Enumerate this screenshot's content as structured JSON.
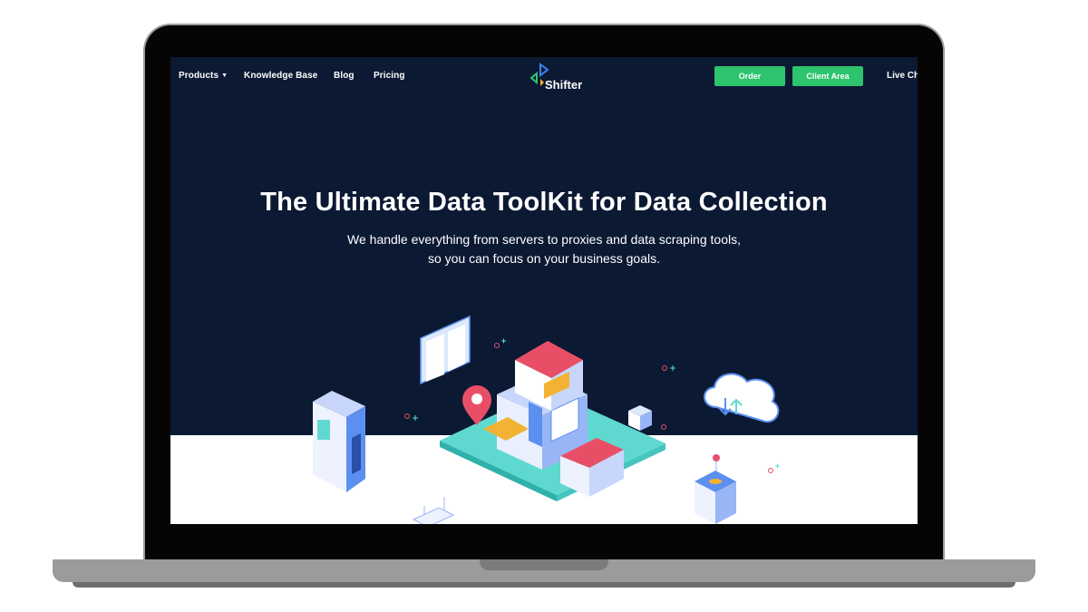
{
  "nav": {
    "products": "Products",
    "knowledge_base": "Knowledge Base",
    "blog": "Blog",
    "pricing": "Pricing",
    "logo_text": "Shifter",
    "order": "Order",
    "client_area": "Client Area",
    "live_chat": "Live Ch"
  },
  "hero": {
    "title": "The Ultimate Data ToolKit for Data Collection",
    "subtitle_line1": "We handle everything from servers to proxies and data scraping tools,",
    "subtitle_line2": "so you can focus on your business goals."
  },
  "colors": {
    "page_background": "#0b1933",
    "button_green": "#2dc46d",
    "platform_teal": "#5fd9cf",
    "roof_red": "#e84f67"
  },
  "icons": {
    "products_caret": "caret-down-icon",
    "logo_mark": "shifter-logo-icon"
  }
}
